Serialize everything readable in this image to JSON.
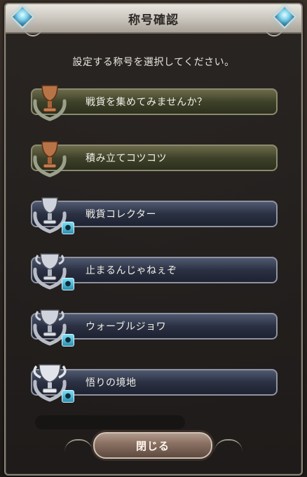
{
  "dialog": {
    "title": "称号確認",
    "instruction": "設定する称号を選択してください。",
    "close_label": "閉じる"
  },
  "titles": [
    {
      "label": "戦貨を集めてみませんか？",
      "tier": "bronze",
      "locked": false
    },
    {
      "label": "積み立てコツコツ",
      "tier": "bronze",
      "locked": false
    },
    {
      "label": "戦貨コレクター",
      "tier": "silver",
      "locked": true
    },
    {
      "label": "止まるんじゃねぇぞ",
      "tier": "silver",
      "locked": true
    },
    {
      "label": "ウォーブルジョワ",
      "tier": "silver",
      "locked": true
    },
    {
      "label": "悟りの境地",
      "tier": "silver",
      "locked": true
    }
  ],
  "colors": {
    "bronze_trophy": "#b87346",
    "silver_trophy": "#cfd3db",
    "lock_accent": "#5cc8e6"
  }
}
